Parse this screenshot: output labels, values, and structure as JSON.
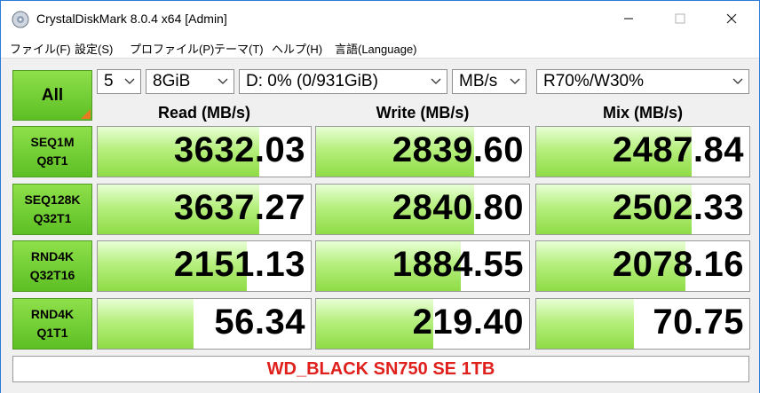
{
  "window": {
    "title": "CrystalDiskMark 8.0.4 x64 [Admin]"
  },
  "menu": [
    "ファイル(F)",
    "設定(S)",
    "プロファイル(P)",
    "テーマ(T)",
    "ヘルプ(H)",
    "言語(Language)"
  ],
  "controls": {
    "all_label": "All",
    "count": "5",
    "size": "8GiB",
    "drive": "D: 0% (0/931GiB)",
    "unit": "MB/s",
    "mix": "R70%/W30%"
  },
  "headers": {
    "read": "Read (MB/s)",
    "write": "Write (MB/s)",
    "mix": "Mix (MB/s)"
  },
  "rows": [
    {
      "line1": "SEQ1M",
      "line2": "Q8T1",
      "read": "3632.03",
      "write": "2839.60",
      "mix": "2487.84",
      "read_fill": 0.76,
      "write_fill": 0.74,
      "mix_fill": 0.73
    },
    {
      "line1": "SEQ128K",
      "line2": "Q32T1",
      "read": "3637.27",
      "write": "2840.80",
      "mix": "2502.33",
      "read_fill": 0.76,
      "write_fill": 0.74,
      "mix_fill": 0.73
    },
    {
      "line1": "RND4K",
      "line2": "Q32T16",
      "read": "2151.13",
      "write": "1884.55",
      "mix": "2078.16",
      "read_fill": 0.7,
      "write_fill": 0.68,
      "mix_fill": 0.7
    },
    {
      "line1": "RND4K",
      "line2": "Q1T1",
      "read": "56.34",
      "write": "219.40",
      "mix": "70.75",
      "read_fill": 0.45,
      "write_fill": 0.55,
      "mix_fill": 0.46
    }
  ],
  "footer": {
    "comment": "WD_BLACK SN750 SE 1TB"
  },
  "colors": {
    "accent_green": "#6fcb2f",
    "footer_text": "#e0201c",
    "title_border": "#2b7bd8"
  }
}
